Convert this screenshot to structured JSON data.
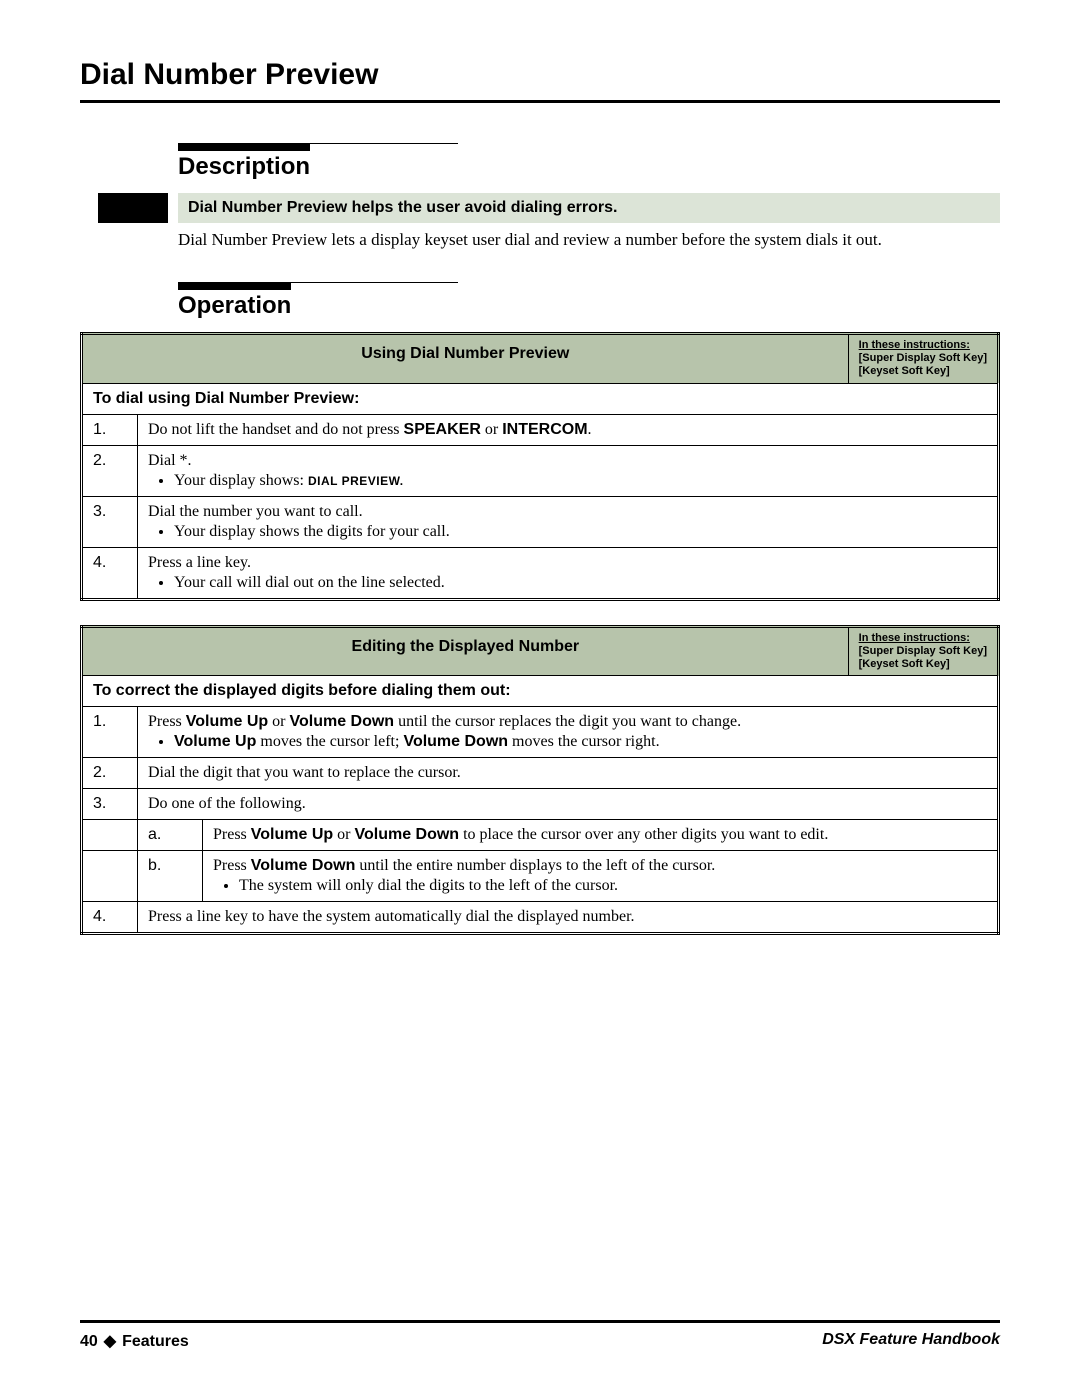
{
  "title": "Dial Number Preview",
  "sections": {
    "description": {
      "heading": "Description",
      "summary": "Dial Number Preview helps the user avoid dialing errors.",
      "body": "Dial Number Preview lets a display keyset user dial and review a number before the system dials it out."
    },
    "operation": {
      "heading": "Operation"
    }
  },
  "instructions_note": {
    "line1": "In these instructions:",
    "line2": "[Super Display Soft Key]",
    "line3": "[Keyset Soft Key]"
  },
  "table1": {
    "title": "Using Dial Number Preview",
    "subheading": "To dial using Dial Number Preview:",
    "steps": [
      {
        "num": "1.",
        "text_pre": "Do not lift the handset and do not press ",
        "bold1": "SPEAKER",
        "mid": " or ",
        "bold2": "INTERCOM",
        "text_post": "."
      },
      {
        "num": "2.",
        "text": "Dial *.",
        "bullet_pre": "Your display shows: ",
        "bullet_sc": "DIAL PREVIEW."
      },
      {
        "num": "3.",
        "text": "Dial the number you want to call.",
        "bullet": "Your display shows the digits for your call."
      },
      {
        "num": "4.",
        "text": "Press a line key.",
        "bullet": "Your call will dial out on the line selected."
      }
    ]
  },
  "table2": {
    "title": "Editing the Displayed Number",
    "subheading": "To correct the displayed digits before dialing them out:",
    "steps": {
      "s1": {
        "num": "1.",
        "pre": "Press ",
        "b1": "Volume Up",
        "mid1": " or ",
        "b2": "Volume Down",
        "post1": " until the cursor replaces the digit you want to change.",
        "bullet_b1": "Volume Up",
        "bullet_mid": " moves the cursor left; ",
        "bullet_b2": "Volume Down",
        "bullet_post": " moves the cursor right."
      },
      "s2": {
        "num": "2.",
        "text": "Dial the digit that you want to replace the cursor."
      },
      "s3": {
        "num": "3.",
        "text": "Do one of the following."
      },
      "s3a": {
        "letter": "a.",
        "pre": "Press ",
        "b1": "Volume Up",
        "mid": " or ",
        "b2": "Volume Down",
        "post": " to place the cursor over any other digits you want to edit."
      },
      "s3b": {
        "letter": "b.",
        "pre": "Press ",
        "b1": "Volume Down",
        "post": " until the entire number displays to the left of the cursor.",
        "bullet": "The system will only dial the digits to the left of the cursor."
      },
      "s4": {
        "num": "4.",
        "text": "Press a line key to have the system automatically dial the displayed number."
      }
    }
  },
  "footer": {
    "page": "40",
    "diamond": "◆",
    "section": "Features",
    "book": "DSX Feature Handbook"
  }
}
